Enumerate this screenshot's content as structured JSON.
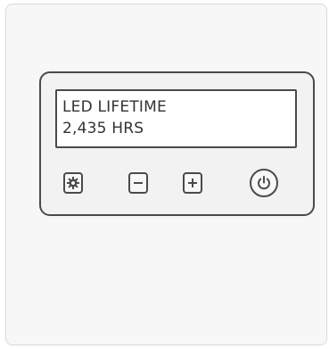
{
  "display": {
    "line1": "LED LIFETIME",
    "line2": "2,435 HRS"
  },
  "buttons": {
    "settings_icon": "gear-icon",
    "minus_icon": "minus-icon",
    "plus_icon": "plus-icon",
    "power_icon": "power-icon"
  },
  "colors": {
    "outline": "#4a4a4a",
    "panel_bg": "#f2f2f2",
    "card_bg": "#f7f7f7",
    "screen_bg": "#ffffff"
  }
}
